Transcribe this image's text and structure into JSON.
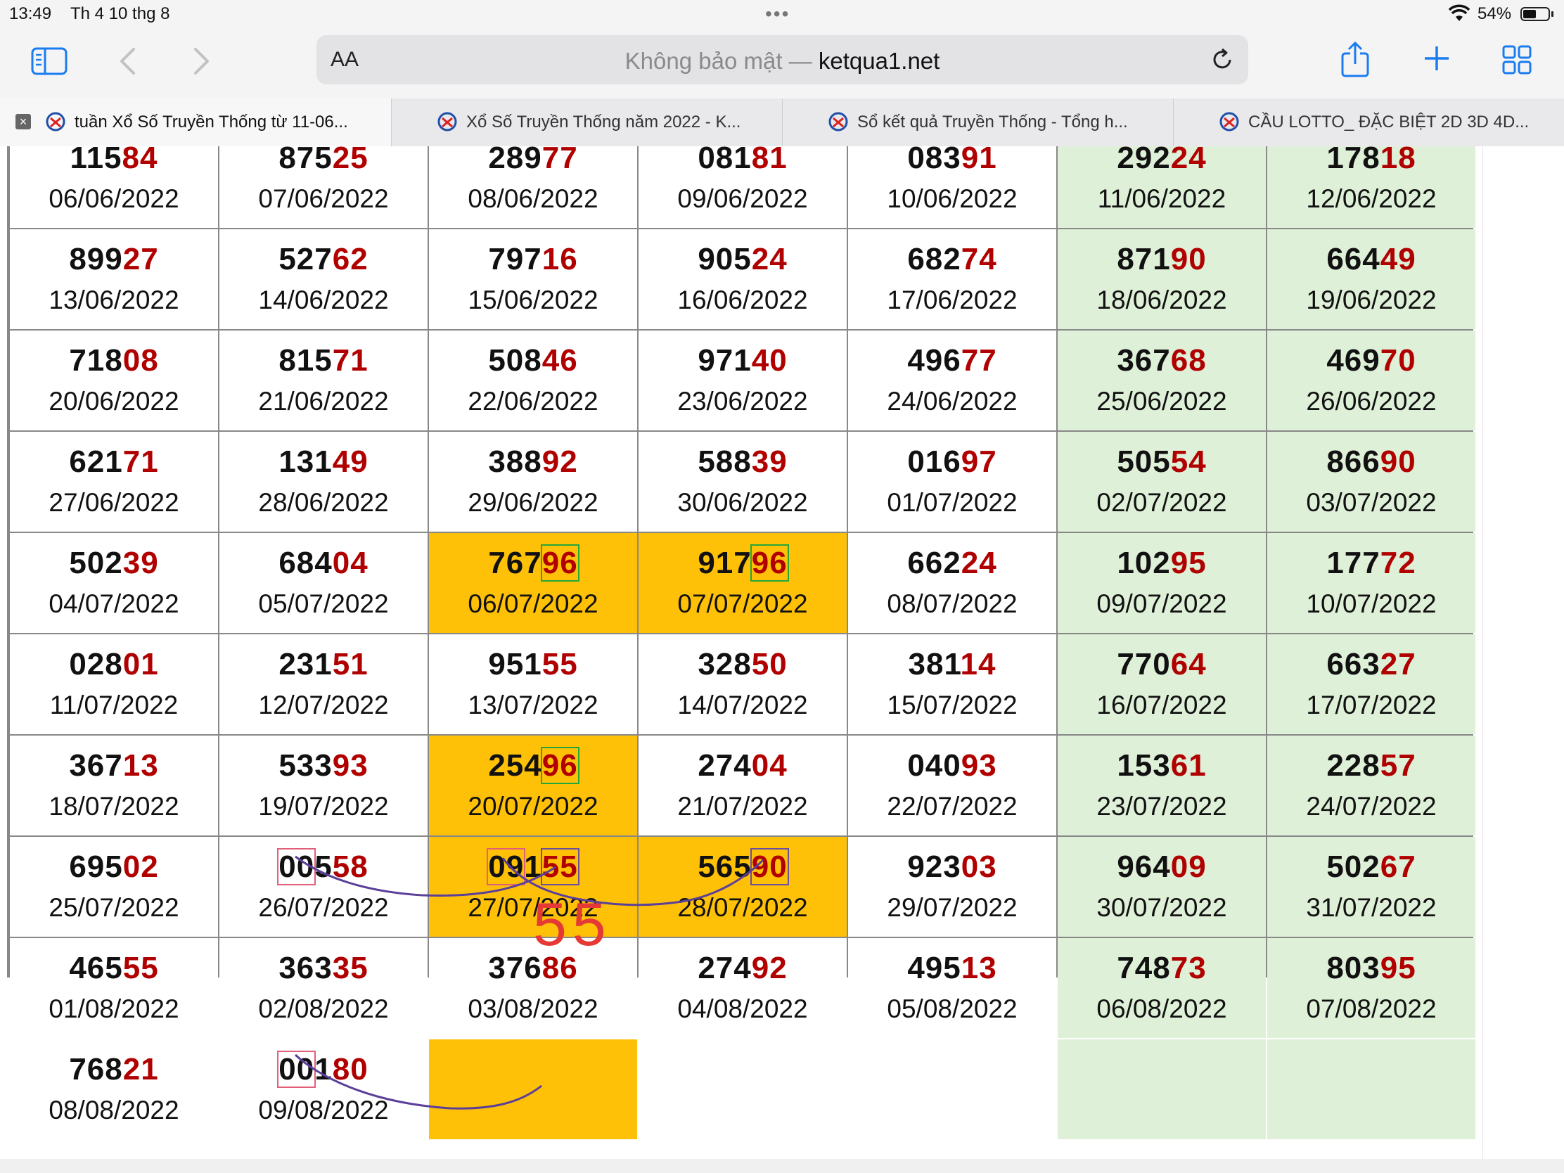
{
  "status": {
    "time": "13:49",
    "date": "Th 4 10 thg 8",
    "battery": "54%",
    "battery_level": 0.54
  },
  "toolbar": {
    "aa_label": "AA",
    "address_not_secure": "Không bảo mật — ",
    "address_domain": "ketqua1.net"
  },
  "tabs": [
    {
      "label": "tuần Xổ Số Truyền Thống từ 11-06...",
      "active": true
    },
    {
      "label": "Xổ Số Truyền Thống năm 2022 - K...",
      "active": false
    },
    {
      "label": "Sổ kết quả Truyền Thống - Tổng h...",
      "active": false
    },
    {
      "label": "CẦU LOTTO_ ĐẶC BIỆT 2D 3D 4D...",
      "active": false
    }
  ],
  "table": {
    "rows": [
      [
        {
          "n": "11584",
          "d": "06/06/2022"
        },
        {
          "n": "87525",
          "d": "07/06/2022"
        },
        {
          "n": "28977",
          "d": "08/06/2022"
        },
        {
          "n": "08181",
          "d": "09/06/2022"
        },
        {
          "n": "08391",
          "d": "10/06/2022"
        },
        {
          "n": "29224",
          "d": "11/06/2022"
        },
        {
          "n": "17818",
          "d": "12/06/2022"
        }
      ],
      [
        {
          "n": "89927",
          "d": "13/06/2022"
        },
        {
          "n": "52762",
          "d": "14/06/2022"
        },
        {
          "n": "79716",
          "d": "15/06/2022"
        },
        {
          "n": "90524",
          "d": "16/06/2022"
        },
        {
          "n": "68274",
          "d": "17/06/2022"
        },
        {
          "n": "87190",
          "d": "18/06/2022"
        },
        {
          "n": "66449",
          "d": "19/06/2022"
        }
      ],
      [
        {
          "n": "71808",
          "d": "20/06/2022"
        },
        {
          "n": "81571",
          "d": "21/06/2022"
        },
        {
          "n": "50846",
          "d": "22/06/2022"
        },
        {
          "n": "97140",
          "d": "23/06/2022"
        },
        {
          "n": "49677",
          "d": "24/06/2022"
        },
        {
          "n": "36768",
          "d": "25/06/2022"
        },
        {
          "n": "46970",
          "d": "26/06/2022"
        }
      ],
      [
        {
          "n": "62171",
          "d": "27/06/2022"
        },
        {
          "n": "13149",
          "d": "28/06/2022"
        },
        {
          "n": "38892",
          "d": "29/06/2022"
        },
        {
          "n": "58839",
          "d": "30/06/2022"
        },
        {
          "n": "01697",
          "d": "01/07/2022"
        },
        {
          "n": "50554",
          "d": "02/07/2022"
        },
        {
          "n": "86690",
          "d": "03/07/2022"
        }
      ],
      [
        {
          "n": "50239",
          "d": "04/07/2022"
        },
        {
          "n": "68404",
          "d": "05/07/2022"
        },
        {
          "n": "76796",
          "d": "06/07/2022",
          "hl": true,
          "tailbox": "green"
        },
        {
          "n": "91796",
          "d": "07/07/2022",
          "hl": true,
          "tailbox": "green"
        },
        {
          "n": "66224",
          "d": "08/07/2022"
        },
        {
          "n": "10295",
          "d": "09/07/2022"
        },
        {
          "n": "17772",
          "d": "10/07/2022"
        }
      ],
      [
        {
          "n": "02801",
          "d": "11/07/2022"
        },
        {
          "n": "23151",
          "d": "12/07/2022"
        },
        {
          "n": "95155",
          "d": "13/07/2022"
        },
        {
          "n": "32850",
          "d": "14/07/2022"
        },
        {
          "n": "38114",
          "d": "15/07/2022"
        },
        {
          "n": "77064",
          "d": "16/07/2022"
        },
        {
          "n": "66327",
          "d": "17/07/2022"
        }
      ],
      [
        {
          "n": "36713",
          "d": "18/07/2022"
        },
        {
          "n": "53393",
          "d": "19/07/2022"
        },
        {
          "n": "25496",
          "d": "20/07/2022",
          "hl": true,
          "tailbox": "green"
        },
        {
          "n": "27404",
          "d": "21/07/2022"
        },
        {
          "n": "04093",
          "d": "22/07/2022"
        },
        {
          "n": "15361",
          "d": "23/07/2022"
        },
        {
          "n": "22857",
          "d": "24/07/2022"
        }
      ],
      [
        {
          "n": "69502",
          "d": "25/07/2022"
        },
        {
          "n": "00558",
          "d": "26/07/2022",
          "headbox": "red"
        },
        {
          "n": "09155",
          "d": "27/07/2022",
          "hl": true,
          "headbox": "red",
          "tailbox": "purple"
        },
        {
          "n": "56590",
          "d": "28/07/2022",
          "hl": true,
          "tailbox": "purple"
        },
        {
          "n": "92303",
          "d": "29/07/2022"
        },
        {
          "n": "96409",
          "d": "30/07/2022"
        },
        {
          "n": "50267",
          "d": "31/07/2022"
        }
      ],
      [
        {
          "n": "46555",
          "d": "01/08/2022"
        },
        {
          "n": "36335",
          "d": "02/08/2022"
        },
        {
          "n": "37686",
          "d": "03/08/2022"
        },
        {
          "n": "27492",
          "d": "04/08/2022"
        },
        {
          "n": "49513",
          "d": "05/08/2022"
        },
        {
          "n": "74873",
          "d": "06/08/2022"
        },
        {
          "n": "80395",
          "d": "07/08/2022"
        }
      ],
      [
        {
          "n": "76821",
          "d": "08/08/2022"
        },
        {
          "n": "00180",
          "d": "09/08/2022",
          "headbox": "red"
        },
        {
          "n": "",
          "d": "",
          "hl": true
        },
        {
          "n": "",
          "d": ""
        },
        {
          "n": "",
          "d": ""
        },
        {
          "n": "",
          "d": ""
        },
        {
          "n": "",
          "d": ""
        }
      ]
    ]
  },
  "annotation": {
    "text": "55"
  },
  "colors": {
    "tail_red": "#b00000",
    "highlight": "#ffc107",
    "weekend": "#dff0d8",
    "ink_purple": "#5b3f99"
  }
}
